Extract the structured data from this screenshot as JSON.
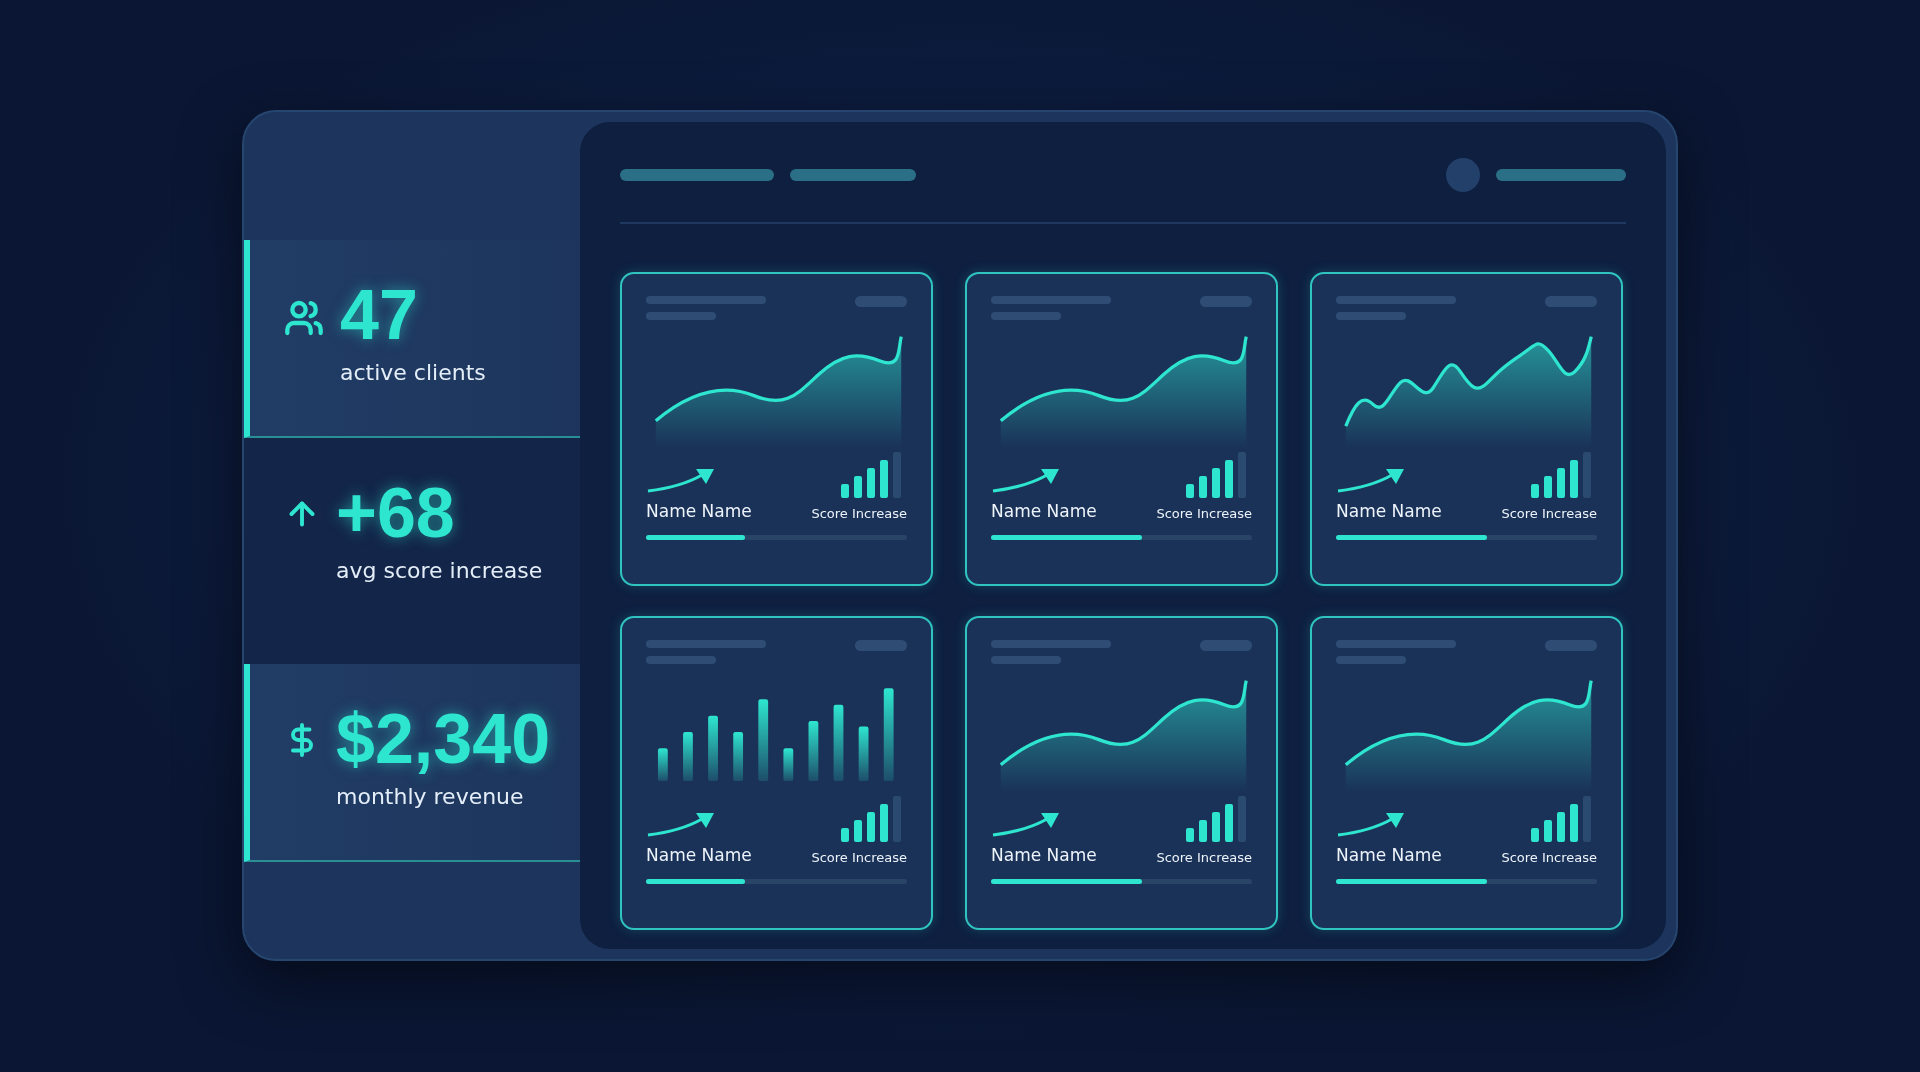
{
  "stats": [
    {
      "kind": "people",
      "value": "47",
      "label": "active clients",
      "highlighted": true
    },
    {
      "kind": "arrow",
      "value": "+68",
      "label": "avg score increase",
      "highlighted": false
    },
    {
      "kind": "money",
      "value": "$2,340",
      "label": "monthly revenue",
      "highlighted": true
    }
  ],
  "cards": [
    {
      "kind": "wave",
      "name": "Name Name",
      "score_label": "Score Increase",
      "level": 0.38
    },
    {
      "kind": "wave",
      "name": "Name Name",
      "score_label": "Score Increase",
      "level": 0.58
    },
    {
      "kind": "bumpy",
      "name": "Name Name",
      "score_label": "Score Increase",
      "level": 0.58
    },
    {
      "kind": "bars",
      "name": "Name Name",
      "score_label": "Score Increase",
      "level": 0.38
    },
    {
      "kind": "wave",
      "name": "Name Name",
      "score_label": "Score Increase",
      "level": 0.58
    },
    {
      "kind": "wave",
      "name": "Name Name",
      "score_label": "Score Increase",
      "level": 0.58
    }
  ]
}
